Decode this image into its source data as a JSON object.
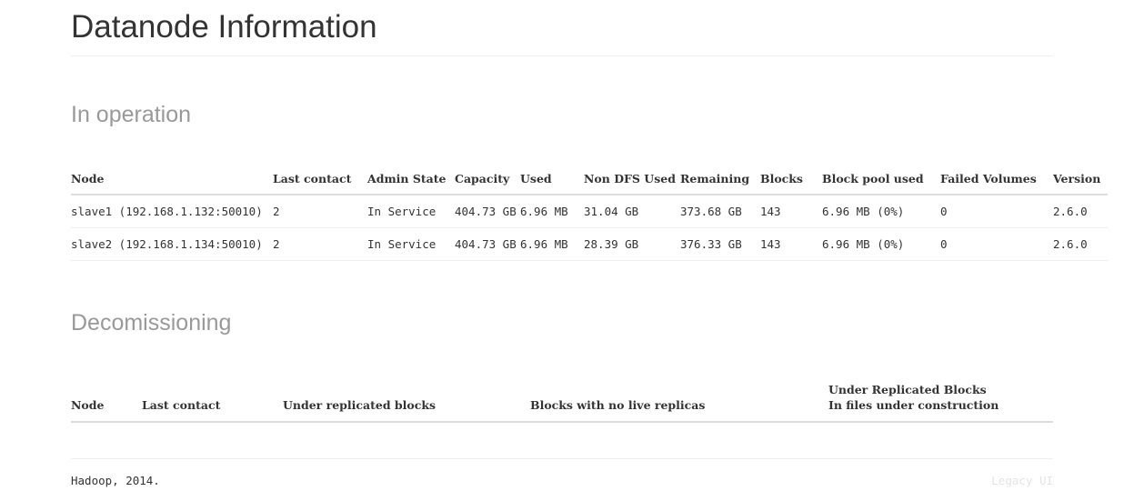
{
  "page": {
    "title": "Datanode Information"
  },
  "sections": {
    "in_operation": {
      "heading": "In operation",
      "columns": [
        "Node",
        "Last contact",
        "Admin State",
        "Capacity",
        "Used",
        "Non DFS Used",
        "Remaining",
        "Blocks",
        "Block pool used",
        "Failed Volumes",
        "Version"
      ],
      "rows": [
        {
          "node": "slave1 (192.168.1.132:50010)",
          "last_contact": "2",
          "admin_state": "In Service",
          "capacity": "404.73 GB",
          "used": "6.96 MB",
          "non_dfs_used": "31.04 GB",
          "remaining": "373.68 GB",
          "blocks": "143",
          "block_pool_used": "6.96 MB (0%)",
          "failed_volumes": "0",
          "version": "2.6.0"
        },
        {
          "node": "slave2 (192.168.1.134:50010)",
          "last_contact": "2",
          "admin_state": "In Service",
          "capacity": "404.73 GB",
          "used": "6.96 MB",
          "non_dfs_used": "28.39 GB",
          "remaining": "376.33 GB",
          "blocks": "143",
          "block_pool_used": "6.96 MB (0%)",
          "failed_volumes": "0",
          "version": "2.6.0"
        }
      ]
    },
    "decommissioning": {
      "heading": "Decomissioning",
      "columns": [
        "Node",
        "Last contact",
        "Under replicated blocks",
        "Blocks with no live replicas",
        "Under Replicated Blocks",
        "In files under construction"
      ],
      "rows": []
    }
  },
  "footer": {
    "copyright": "Hadoop, 2014.",
    "legacy_link": "Legacy UI"
  }
}
